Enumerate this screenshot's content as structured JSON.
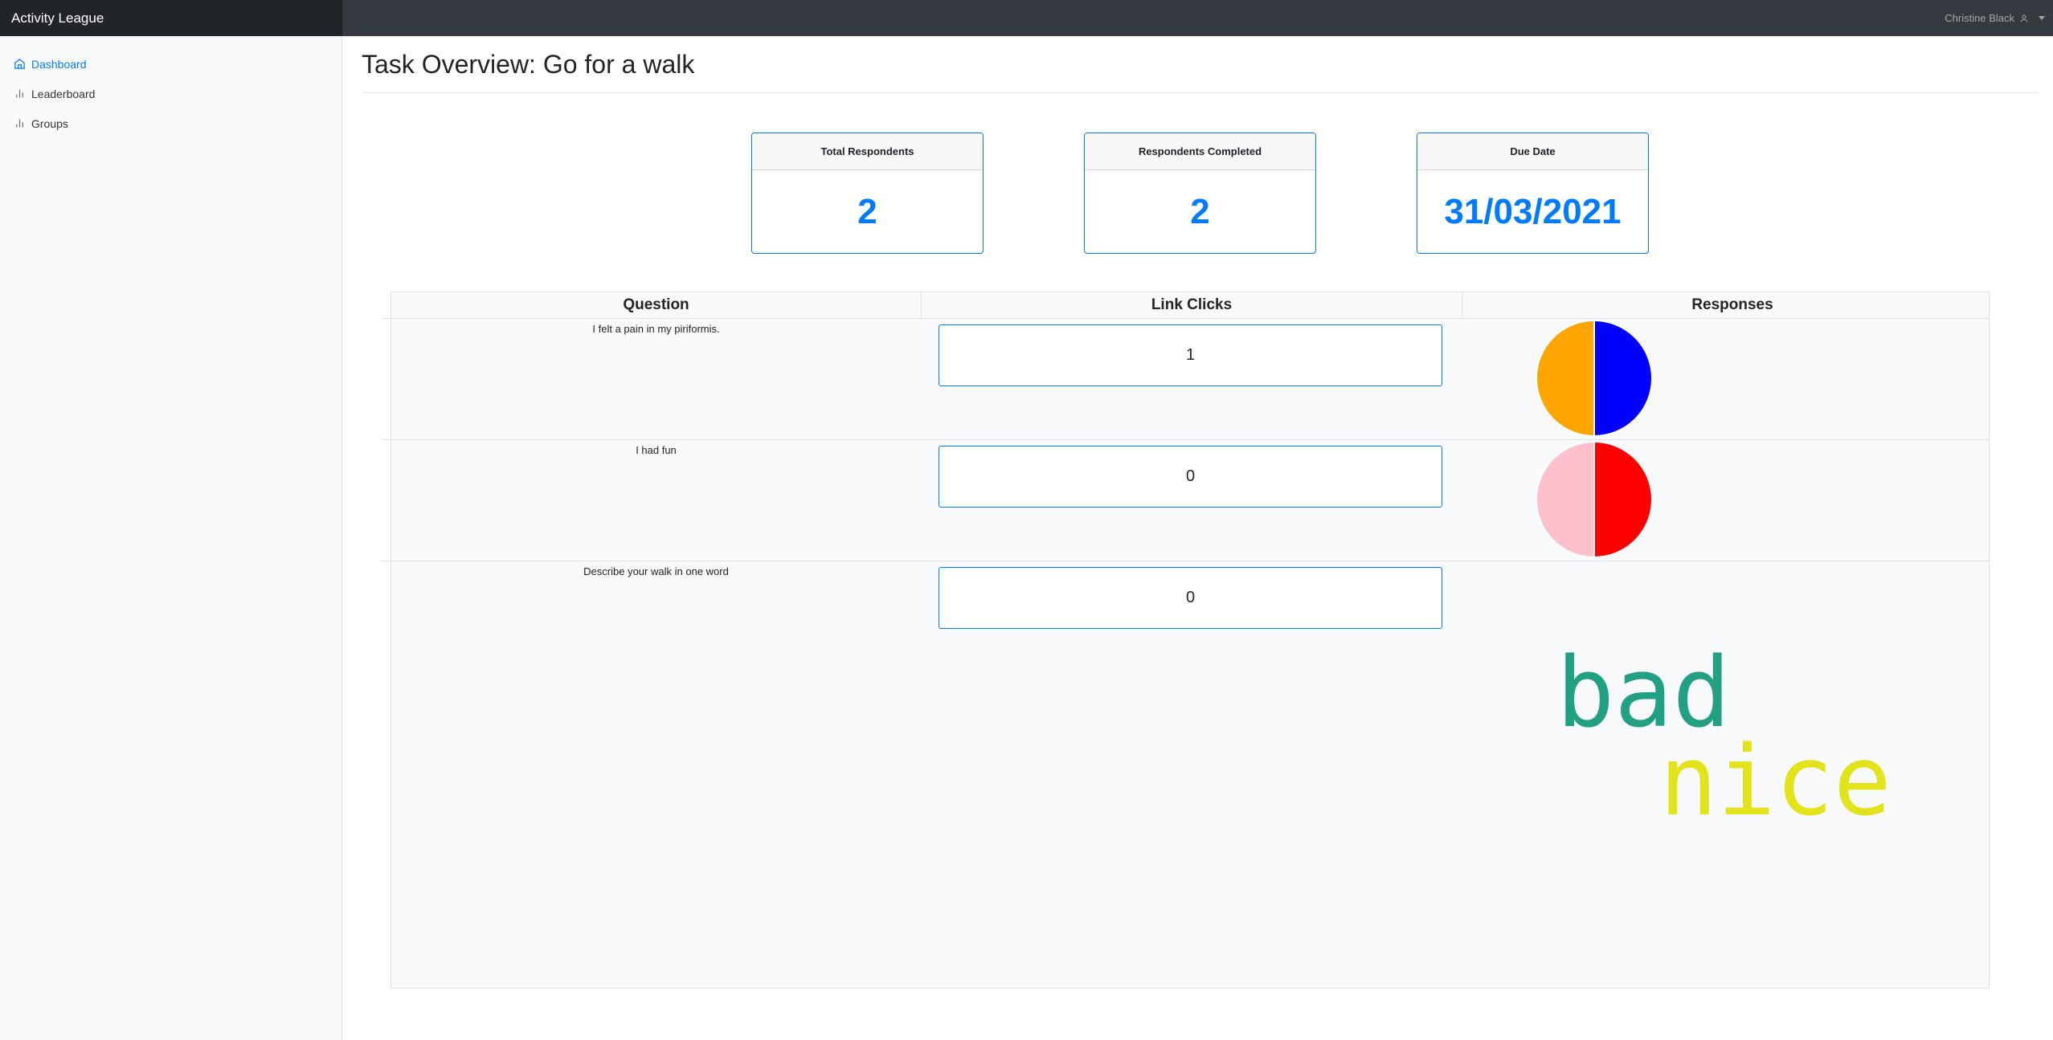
{
  "app": {
    "brand": "Activity League"
  },
  "user": {
    "name": "Christine Black"
  },
  "sidebar": {
    "items": [
      {
        "label": "Dashboard",
        "active": true,
        "icon": "home-icon"
      },
      {
        "label": "Leaderboard",
        "active": false,
        "icon": "bar-chart-icon"
      },
      {
        "label": "Groups",
        "active": false,
        "icon": "bar-chart-icon"
      }
    ]
  },
  "page": {
    "title": "Task Overview: Go for a walk"
  },
  "stats": [
    {
      "label": "Total Respondents",
      "value": "2"
    },
    {
      "label": "Respondents Completed",
      "value": "2"
    },
    {
      "label": "Due Date",
      "value": "31/03/2021"
    }
  ],
  "table": {
    "headers": [
      "Question",
      "Link Clicks",
      "Responses"
    ],
    "rows": [
      {
        "question": "I felt a pain in my piriformis.",
        "clicks": "1",
        "responses": {
          "type": "pie",
          "slices": [
            {
              "value": 1,
              "color": "#0000ff"
            },
            {
              "value": 1,
              "color": "#ffa500"
            }
          ]
        }
      },
      {
        "question": "I had fun",
        "clicks": "0",
        "responses": {
          "type": "pie",
          "slices": [
            {
              "value": 1,
              "color": "#ff0000"
            },
            {
              "value": 1,
              "color": "#ffc0cb"
            }
          ]
        }
      },
      {
        "question": "Describe your walk in one word",
        "clicks": "0",
        "responses": {
          "type": "wordcloud",
          "words": [
            {
              "text": "bad",
              "color": "#21a083"
            },
            {
              "text": "nice",
              "color": "#e3e31c"
            }
          ]
        }
      }
    ]
  },
  "colors": {
    "accent": "#007bff",
    "navbar": "#343a40",
    "brand_bg": "#212529"
  }
}
